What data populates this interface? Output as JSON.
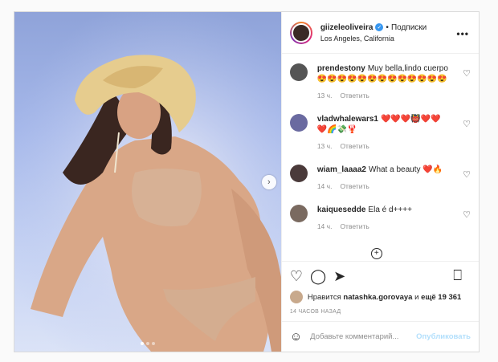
{
  "post": {
    "username": "giizeleoliveira",
    "verified_icon": "✓",
    "separator": "•",
    "follow_label": "Подписки",
    "location": "Los Angeles, California",
    "more_icon": "•••"
  },
  "media": {
    "next_icon": "›",
    "carousel_count": 3,
    "carousel_active": 0
  },
  "comments": [
    {
      "username": "prendestony",
      "text": "Muy bella,lindo cuerpo😍😍😍😍😍😍😍😍😍😍😍😍😍",
      "time": "13 ч.",
      "reply": "Ответить",
      "avatar_color": "#555"
    },
    {
      "username": "vladwhalewars1",
      "text": "❤️❤️❤️👹❤️❤️❤️🌈💸🦞",
      "time": "13 ч.",
      "reply": "Ответить",
      "avatar_color": "#6a6aa0"
    },
    {
      "username": "wiam_laaaa2",
      "text": "What a beauty ❤️🔥",
      "time": "14 ч.",
      "reply": "Ответить",
      "avatar_color": "#4a3a3a"
    },
    {
      "username": "kaiquesedde",
      "text": "Ela é d++++",
      "time": "14 ч.",
      "reply": "Ответить",
      "avatar_color": "#7a6a60"
    }
  ],
  "comments_load_more_icon": "+",
  "actions": {
    "like_icon": "♡",
    "comment_icon": "◯",
    "share_icon": "➤",
    "bookmark_icon": "⎕"
  },
  "likes": {
    "prefix": "Нравится",
    "user": "natashka.gorovaya",
    "middle": "и",
    "count": "ещё 19 361"
  },
  "timestamp": "14 ЧАСОВ НАЗАД",
  "add_comment": {
    "emoji_icon": "☺",
    "placeholder": "Добавьте комментарий...",
    "publish_label": "Опубликовать"
  },
  "colors": {
    "accent": "#0095f6",
    "publish_disabled": "#b2dffc",
    "verified": "#3897f0"
  }
}
